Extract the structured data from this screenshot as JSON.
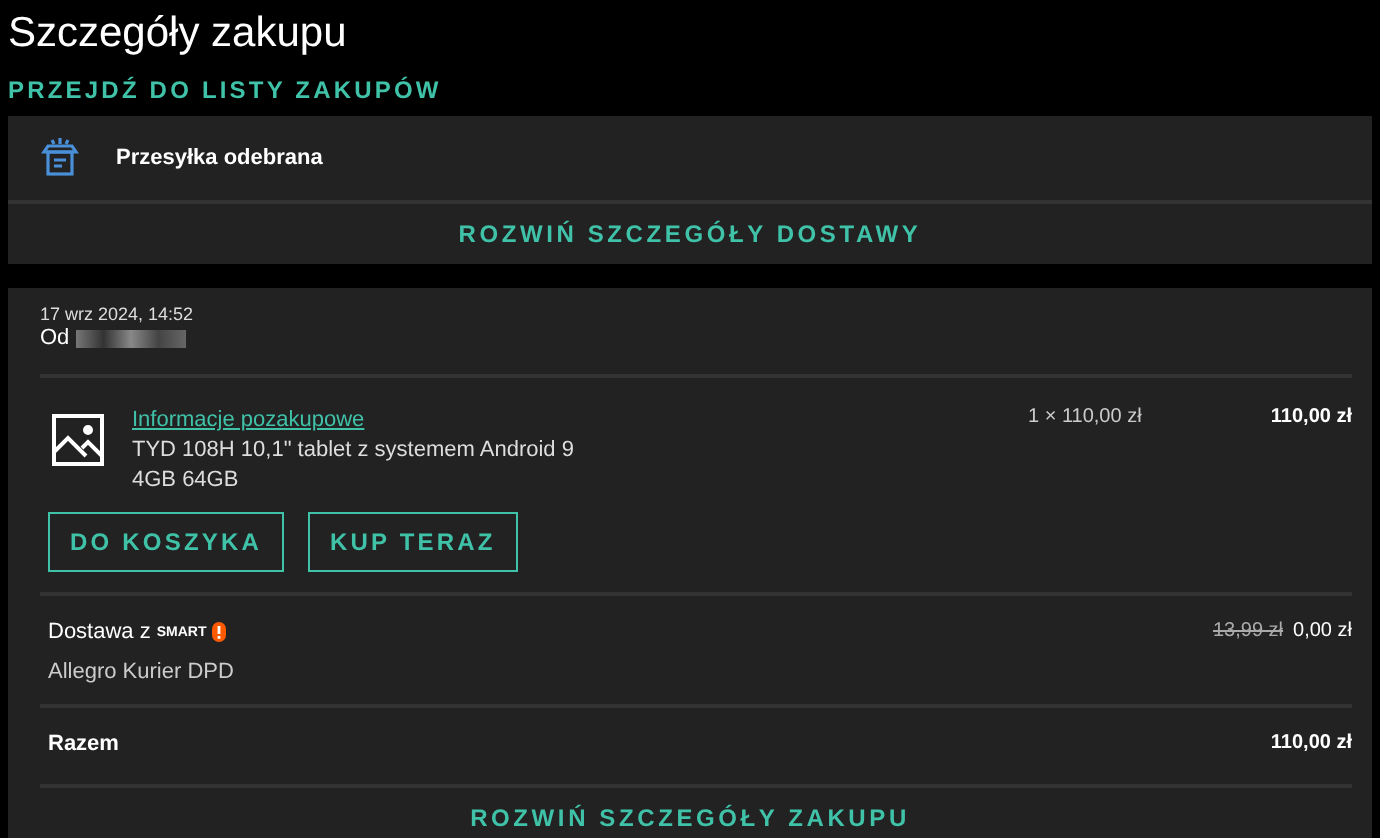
{
  "title": "Szczegóły zakupu",
  "back_link": "PRZEJDŹ DO LISTY ZAKUPÓW",
  "shipment": {
    "status": "Przesyłka odebrana",
    "expand": "ROZWIŃ SZCZEGÓŁY DOSTAWY"
  },
  "purchase": {
    "date": "17 wrz 2024, 14:52",
    "seller_label": "Od",
    "item": {
      "link": "Informacje pozakupowe",
      "name": "TYD 108H 10,1\" tablet z systemem Android 9 4GB 64GB",
      "quantity_price": "1 × 110,00 zł",
      "total": "110,00 zł"
    },
    "buttons": [
      "DO KOSZYKA",
      "KUP TERAZ"
    ],
    "delivery": {
      "label": "Dostawa z",
      "badge": "SMART",
      "method": "Allegro Kurier DPD",
      "old_price": "13,99 zł",
      "price": "0,00 zł"
    },
    "sum": {
      "label": "Razem",
      "value": "110,00 zł"
    },
    "expand": "ROZWIŃ SZCZEGÓŁY ZAKUPU"
  }
}
